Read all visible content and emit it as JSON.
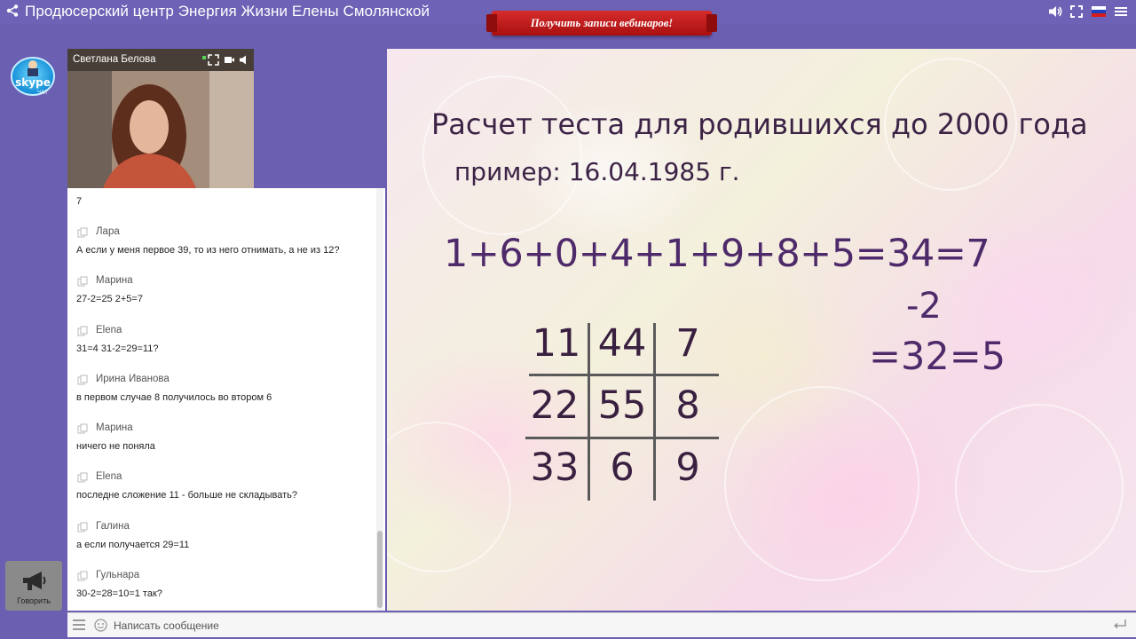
{
  "header": {
    "title": "Продюсерский центр Энергия Жизни Елены Смолянской",
    "promo_label": "Получить записи вебинаров!"
  },
  "left_rail": {
    "skype_label": "skype",
    "skype_sublabel": "ЧАТ",
    "speak_label": "Говорить"
  },
  "video": {
    "presenter_name": "Светлана Белова"
  },
  "chat": {
    "first_line": "7",
    "messages": [
      {
        "author": "Лара",
        "text": "А если у меня первое 39, то из него отнимать, а не из 12?"
      },
      {
        "author": "Марина",
        "text": "27-2=25 2+5=7"
      },
      {
        "author": "Elena",
        "text": "31=4 31-2=29=11?"
      },
      {
        "author": "Ирина Иванова",
        "text": "в первом случае 8 получилось во втором 6"
      },
      {
        "author": "Марина",
        "text": "ничего не поняла"
      },
      {
        "author": "Elena",
        "text": "последне сложение 11 - больше не складывать?"
      },
      {
        "author": "Галина",
        "text": "а если получается 29=11"
      },
      {
        "author": "Гульнара",
        "text": "30-2=28=10=1 так?"
      }
    ]
  },
  "input": {
    "placeholder": "Написать сообщение"
  },
  "slide": {
    "title": "Расчет теста для родившихся до 2000 года",
    "example": "пример: 16.04.1985 г.",
    "formula": "1+6+0+4+1+9+8+5=34=7",
    "minus": "-2",
    "result": "=32=5",
    "grid": [
      [
        "11",
        "44",
        "7"
      ],
      [
        "22",
        "55",
        "8"
      ],
      [
        "33",
        "6",
        "9"
      ]
    ]
  },
  "colors": {
    "frame": "#6b5fb2",
    "promo": "#c81f20",
    "slide_text": "#4e2a6a"
  }
}
